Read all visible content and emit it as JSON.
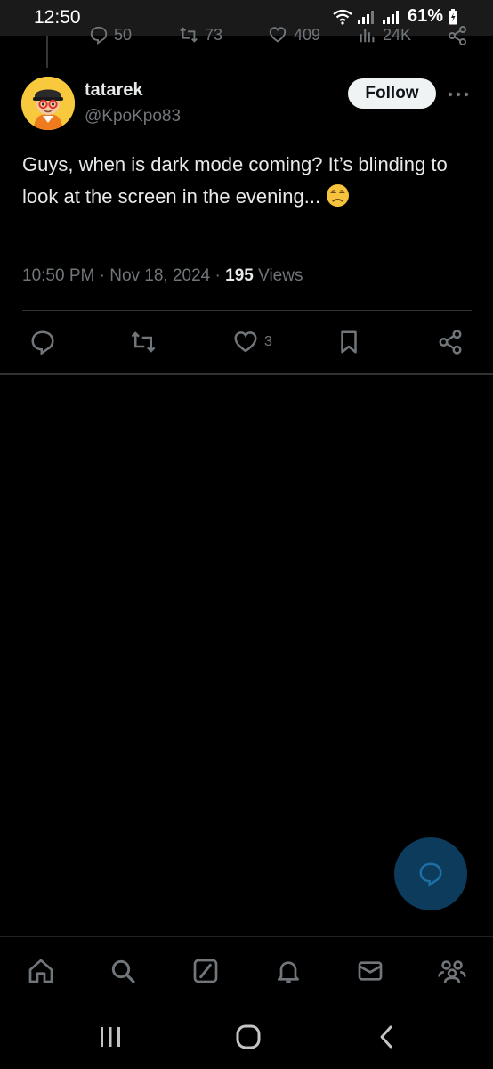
{
  "status_bar": {
    "time": "12:50",
    "battery": "61%"
  },
  "previous_tweet": {
    "reply_count": "50",
    "retweet_count": "73",
    "like_count": "409",
    "view_count": "24K"
  },
  "tweet": {
    "author_name": "tatarek",
    "author_handle": "@KpoKpo83",
    "follow_label": "Follow",
    "text": "Guys, when is dark mode coming? It’s blinding to look at the screen in the evening...",
    "emoji": "unamused-face",
    "time": "10:50 PM",
    "date": "Nov 18, 2024",
    "views_count": "195",
    "views_label": "Views",
    "separator": "·"
  },
  "actions": {
    "like_count": "3"
  },
  "icons": {
    "reply": "reply-icon",
    "retweet": "retweet-icon",
    "like": "heart-icon",
    "bookmark": "bookmark-icon",
    "share": "share-icon",
    "more": "more-icon",
    "compose_reply": "compose-reply-icon"
  },
  "bottom_nav": [
    "home-icon",
    "search-icon",
    "grok-icon",
    "notifications-icon",
    "messages-icon",
    "communities-icon"
  ],
  "system_nav": [
    "recents-icon",
    "home-button-icon",
    "back-icon"
  ],
  "colors": {
    "background": "#000000",
    "text_primary": "#e7e9ea",
    "text_secondary": "#71767b",
    "divider": "#2f3336",
    "fab": "#0c3b5c",
    "follow_button": "#eff3f4"
  }
}
